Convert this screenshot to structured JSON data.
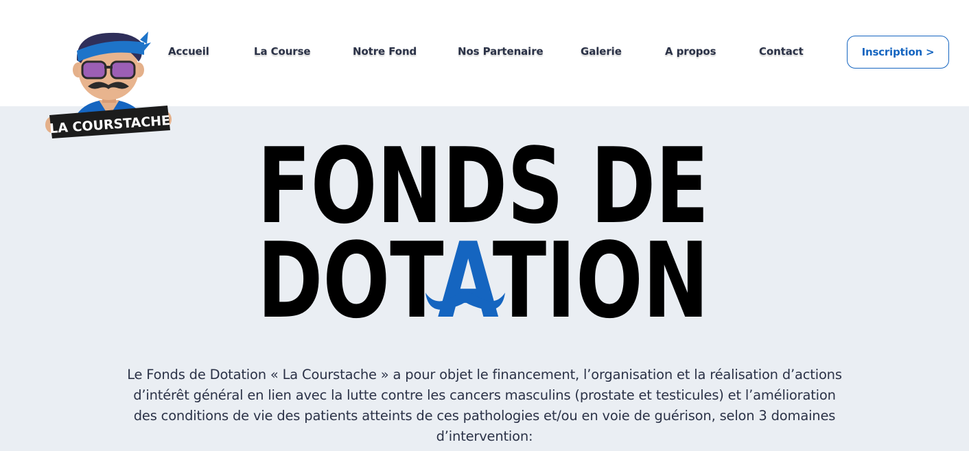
{
  "brand": {
    "logo_text": "LA COURSTACHE",
    "colors": {
      "accent_blue": "#1565c0",
      "hero_background": "#eaeef3",
      "text": "#2b3247",
      "title": "#000000"
    }
  },
  "nav": {
    "items": [
      {
        "label": "Accueil"
      },
      {
        "label": "La Course"
      },
      {
        "label": "Notre Fond"
      },
      {
        "label": "Nos Partenaire"
      },
      {
        "label": "Galerie"
      },
      {
        "label": "A propos"
      },
      {
        "label": "Contact"
      }
    ],
    "cta_label": "Inscription >"
  },
  "hero": {
    "title_line1": "FONDS DE",
    "title_line2_before": "DOT",
    "title_line2_accent": "A",
    "title_line2_after": "TION",
    "accent_icon": "mustache-icon",
    "description": "Le Fonds de Dotation « La Courstache » a pour objet le financement, l’organisation et la réalisation d’actions d’intérêt général en lien avec la lutte contre les cancers masculins (prostate et testicules) et l’amélioration des conditions de vie des patients atteints de ces pathologies et/ou en voie de guérison, selon 3 domaines d’intervention:"
  }
}
